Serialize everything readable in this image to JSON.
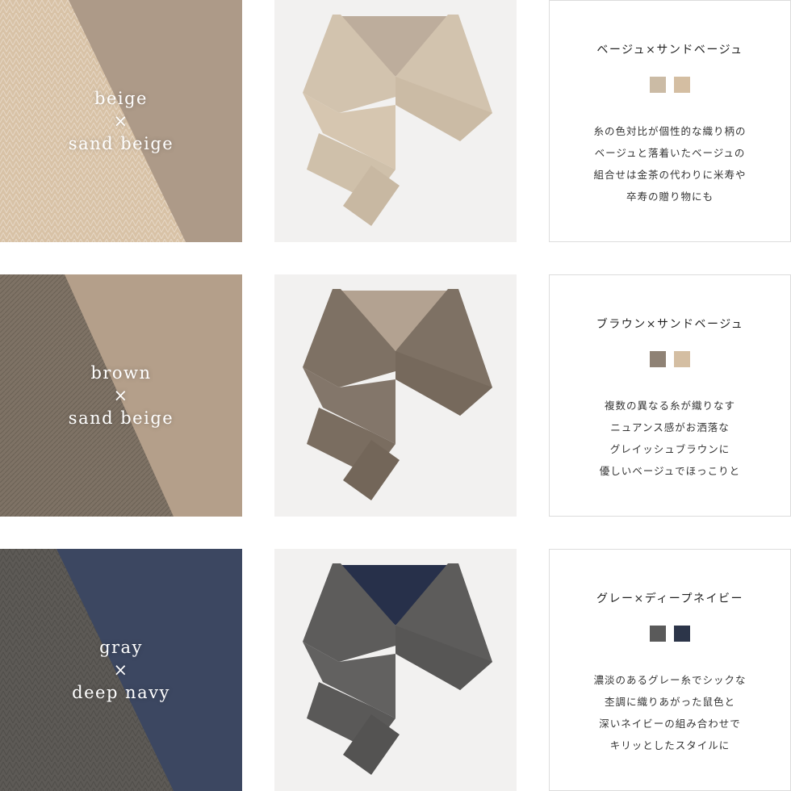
{
  "rows": [
    {
      "swatch": {
        "line1": "beige",
        "times": "×",
        "line2": "sand beige"
      },
      "title": "ベージュ×サンドベージュ",
      "colors": {
        "outer": "#cbbba5",
        "lining": "#b9a999",
        "chip1": "#cbbba5",
        "chip2": "#d4bea2"
      },
      "desc": [
        "糸の色対比が個性的な織り柄の",
        "ベージュと落着いたベージュの",
        "組合せは金茶の代わりに米寿や",
        "卒寿の贈り物にも"
      ]
    },
    {
      "swatch": {
        "line1": "brown",
        "times": "×",
        "line2": "sand beige"
      },
      "title": "ブラウン×サンドベージュ",
      "colors": {
        "outer": "#7e7164",
        "lining": "#b9a999",
        "chip1": "#8f8275",
        "chip2": "#d4bea2"
      },
      "desc": [
        "複数の異なる糸が織りなす",
        "ニュアンス感がお洒落な",
        "グレイッシュブラウンに",
        "優しいベージュでほっこりと"
      ]
    },
    {
      "swatch": {
        "line1": "gray",
        "times": "×",
        "line2": "deep navy"
      },
      "title": "グレー×ディープネイビー",
      "colors": {
        "outer": "#5d5c5b",
        "lining": "#27304a",
        "chip1": "#5a5a5a",
        "chip2": "#2c3549"
      },
      "desc": [
        "濃淡のあるグレー糸でシックな",
        "杢調に織りあがった鼠色と",
        "深いネイビーの組み合わせで",
        "キリッとしたスタイルに"
      ]
    }
  ]
}
